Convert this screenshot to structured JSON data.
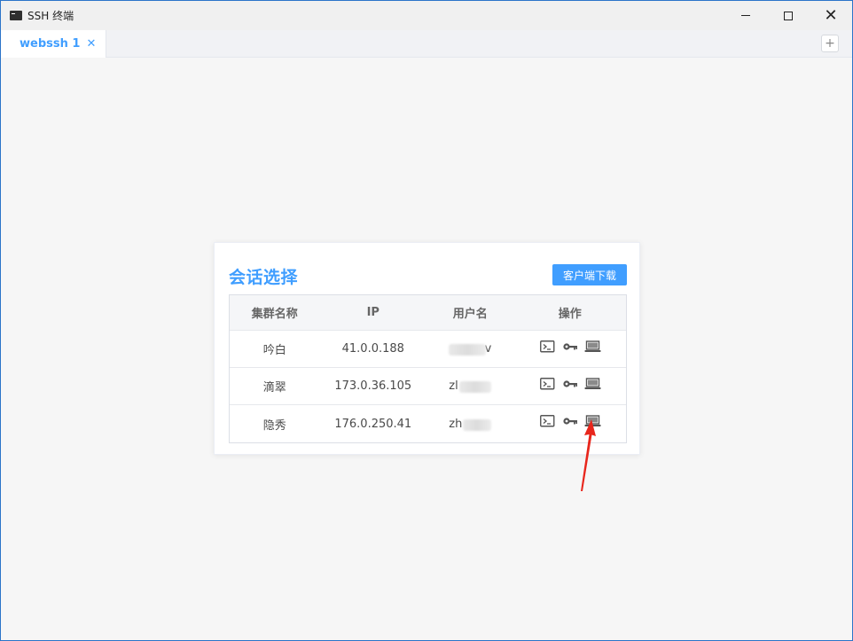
{
  "window": {
    "title": "SSH 终端"
  },
  "tabs": [
    {
      "label": "webssh 1"
    }
  ],
  "card": {
    "title": "会话选择",
    "download_label": "客户端下载",
    "columns": [
      "集群名称",
      "IP",
      "用户名",
      "操作"
    ],
    "rows": [
      {
        "cluster": "吟白",
        "ip": "41.0.0.188",
        "user_visible": "",
        "user_tail": "v"
      },
      {
        "cluster": "滴翠",
        "ip": "173.0.36.105",
        "user_visible": "zl",
        "user_tail": ""
      },
      {
        "cluster": "隐秀",
        "ip": "176.0.250.41",
        "user_visible": "zh",
        "user_tail": ""
      }
    ],
    "operation_icons": [
      "terminal-icon",
      "key-icon",
      "laptop-icon"
    ]
  },
  "colors": {
    "accent": "#409eff",
    "annotation": "#e8261c"
  }
}
